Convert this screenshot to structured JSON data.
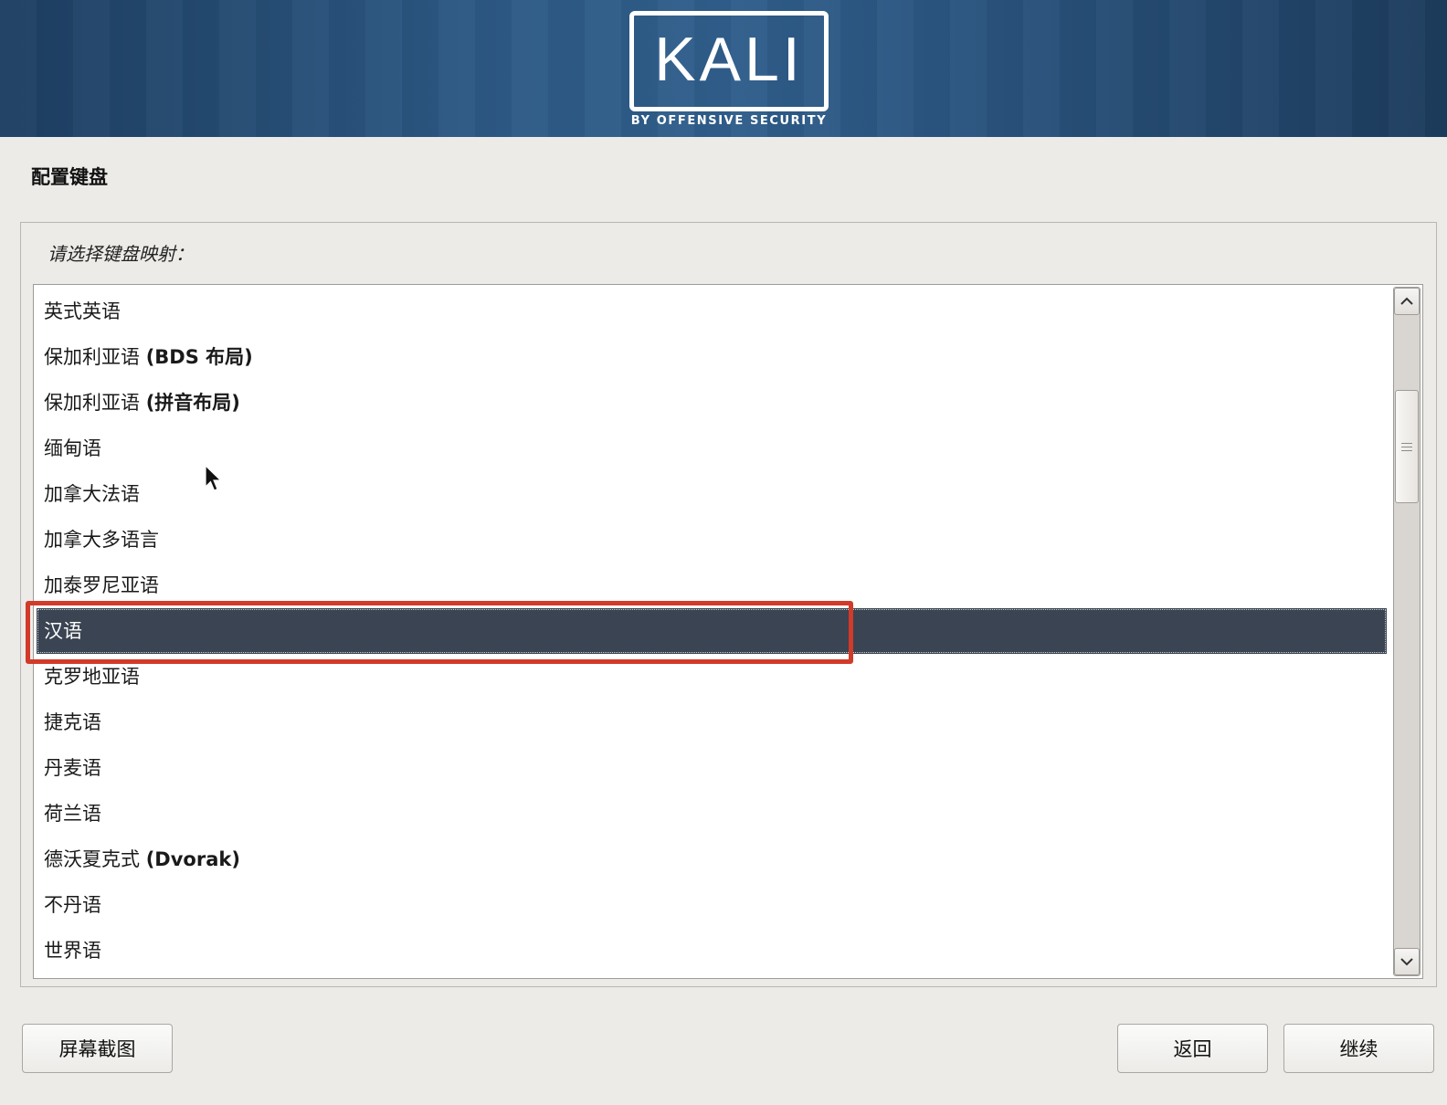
{
  "banner": {
    "logo_text": "KALI",
    "logo_subtitle": "BY OFFENSIVE SECURITY"
  },
  "page": {
    "title": "配置键盘",
    "prompt": "请选择键盘映射："
  },
  "list": {
    "items": [
      {
        "label": "英式英语",
        "suffix": ""
      },
      {
        "label": "保加利亚语 ",
        "suffix": "(BDS 布局)"
      },
      {
        "label": "保加利亚语 ",
        "suffix": "(拼音布局)"
      },
      {
        "label": "缅甸语",
        "suffix": ""
      },
      {
        "label": "加拿大法语",
        "suffix": ""
      },
      {
        "label": "加拿大多语言",
        "suffix": ""
      },
      {
        "label": "加泰罗尼亚语",
        "suffix": ""
      },
      {
        "label": "汉语",
        "suffix": ""
      },
      {
        "label": "克罗地亚语",
        "suffix": ""
      },
      {
        "label": "捷克语",
        "suffix": ""
      },
      {
        "label": "丹麦语",
        "suffix": ""
      },
      {
        "label": "荷兰语",
        "suffix": ""
      },
      {
        "label": "德沃夏克式 ",
        "suffix": "(Dvorak)"
      },
      {
        "label": "不丹语",
        "suffix": ""
      },
      {
        "label": "世界语",
        "suffix": ""
      }
    ],
    "selected_index": 7,
    "selected_label": "汉语",
    "scroll_position": 0.15
  },
  "buttons": {
    "screenshot": "屏幕截图",
    "back": "返回",
    "continue": "继续"
  },
  "colors": {
    "banner": "#2d5a86",
    "selected_row": "#3a4452",
    "annotation": "#d23a2a",
    "background": "#edebe8"
  },
  "icons": {
    "scroll_up": "chevron-up-icon",
    "scroll_down": "chevron-down-icon",
    "cursor": "mouse-pointer-icon"
  }
}
